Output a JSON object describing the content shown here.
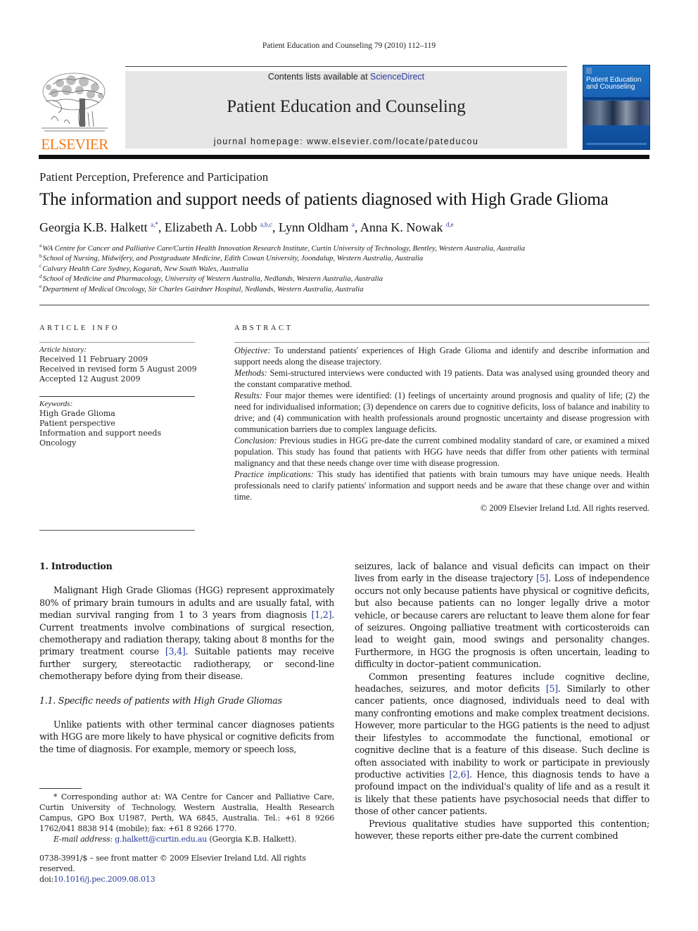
{
  "running_head": "Patient Education and Counseling 79 (2010) 112–119",
  "masthead": {
    "publisher_logo": "ELSEVIER",
    "contents_prefix": "Contents lists available at ",
    "contents_link": "ScienceDirect",
    "journal_title": "Patient Education and Counseling",
    "homepage": "journal homepage: www.elsevier.com/locate/pateducou",
    "cover_title_line1": "Patient Education",
    "cover_title_line2": "and Counseling",
    "colors": {
      "banner_bg": "#e6e6e6",
      "elsevier_orange": "#f07a1a",
      "cover_blue": "#1a62b4",
      "link_blue": "#2a3a9a"
    }
  },
  "section_label": "Patient Perception, Preference and Participation",
  "title": "The information and support needs of patients diagnosed with High Grade Glioma",
  "authors": [
    {
      "name": "Georgia K.B. Halkett",
      "sup": "a,*"
    },
    {
      "name": "Elizabeth A. Lobb",
      "sup": "a,b,c"
    },
    {
      "name": "Lynn Oldham",
      "sup": "a"
    },
    {
      "name": "Anna K. Nowak",
      "sup": "d,e"
    }
  ],
  "affiliations": [
    {
      "key": "a",
      "text": "WA Centre for Cancer and Palliative Care/Curtin Health Innovation Research Institute, Curtin University of Technology, Bentley, Western Australia, Australia"
    },
    {
      "key": "b",
      "text": "School of Nursing, Midwifery, and Postgraduate Medicine, Edith Cowan University, Joondalup, Western Australia, Australia"
    },
    {
      "key": "c",
      "text": "Calvary Health Care Sydney, Kogarah, New South Wales, Australia"
    },
    {
      "key": "d",
      "text": "School of Medicine and Pharmacology, University of Western Australia, Nedlands, Western Australia, Australia"
    },
    {
      "key": "e",
      "text": "Department of Medical Oncology, Sir Charles Gairdner Hospital, Nedlands, Western Australia, Australia"
    }
  ],
  "article_info": {
    "heading": "ARTICLE INFO",
    "history_label": "Article history:",
    "history": [
      "Received 11 February 2009",
      "Received in revised form 5 August 2009",
      "Accepted 12 August 2009"
    ],
    "keywords_label": "Keywords:",
    "keywords": [
      "High Grade Glioma",
      "Patient perspective",
      "Information and support needs",
      "Oncology"
    ]
  },
  "abstract": {
    "heading": "ABSTRACT",
    "sections": [
      {
        "label": "Objective:",
        "text": " To understand patients' experiences of High Grade Glioma and identify and describe information and support needs along the disease trajectory."
      },
      {
        "label": "Methods:",
        "text": " Semi-structured interviews were conducted with 19 patients. Data was analysed using grounded theory and the constant comparative method."
      },
      {
        "label": "Results:",
        "text": "  Four major themes were identified: (1) feelings of uncertainty around prognosis and quality of life; (2) the need for individualised information; (3) dependence on carers due to cognitive deficits, loss of balance and inability to drive; and (4) communication with health professionals around prognostic uncertainty and disease progression with communication barriers due to complex language deficits."
      },
      {
        "label": "Conclusion:",
        "text": " Previous studies in HGG pre-date the current combined modality standard of care, or examined a mixed population. This study has found that patients with HGG have needs that differ from other patients with terminal malignancy and that these needs change over time with disease progression."
      },
      {
        "label": "Practice implications:",
        "text": "  This study has identified that patients with brain tumours may have unique needs. Health professionals need to clarify patients' information and support needs and be aware that these change over and within time."
      }
    ],
    "copyright": "© 2009 Elsevier Ireland Ltd. All rights reserved."
  },
  "body": {
    "intro_heading": "1.  Introduction",
    "intro_p1": [
      {
        "t": "Malignant High Grade Gliomas (HGG) represent approximately 80% of primary brain tumours in adults and are usually fatal, with median survival ranging from 1 to 3 years from diagnosis "
      },
      {
        "ref": "[1,2]"
      },
      {
        "t": ". Current treatments involve combinations of surgical resection, chemotherapy and radiation therapy, taking about 8 months for the primary treatment course "
      },
      {
        "ref": "[3,4]"
      },
      {
        "t": ". Suitable patients may receive further surgery, stereotactic radiotherapy, or second-line chemotherapy before dying from their disease."
      }
    ],
    "subsection_heading": "1.1.  Specific needs of patients with High Grade Gliomas",
    "sub_p1": "Unlike patients with other terminal cancer diagnoses patients with HGG are more likely to have physical or cognitive deficits from the time of diagnosis. For example, memory or speech loss,",
    "right_p1": [
      {
        "t": "seizures, lack of balance and visual deficits can impact on their lives from early in the disease trajectory "
      },
      {
        "ref": "[5]"
      },
      {
        "t": ". Loss of independence occurs not only because patients have physical or cognitive deficits, but also because patients can no longer legally drive a motor vehicle, or because carers are reluctant to leave them alone for fear of seizures. Ongoing palliative treatment with corticosteroids can lead to weight gain, mood swings and personality changes. Furthermore, in HGG the prognosis is often uncertain, leading to difficulty in doctor–patient communication."
      }
    ],
    "right_p2": [
      {
        "t": "Common presenting features include cognitive decline, headaches, seizures, and motor deficits "
      },
      {
        "ref": "[5]"
      },
      {
        "t": ". Similarly to other cancer patients, once diagnosed, individuals need to deal with many confronting emotions and make complex treatment decisions. However, more particular to the HGG patients is the need to adjust their lifestyles to accommodate the functional, emotional or cognitive decline that is a feature of this disease. Such decline is often associated with inability to work or participate in previously productive activities "
      },
      {
        "ref": "[2,6]"
      },
      {
        "t": ". Hence, this diagnosis tends to have a profound impact on the individual's quality of life and as a result it is likely that these patients have psychosocial needs that differ to those of other cancer patients."
      }
    ],
    "right_p3": "Previous qualitative studies have supported this contention; however, these reports either pre-date the current combined"
  },
  "footnote": {
    "corresponding": "* Corresponding author at: WA Centre for Cancer and Palliative Care, Curtin University of Technology, Western Australia, Health Research Campus, GPO Box U1987, Perth, WA 6845, Australia. Tel.: +61 8 9266 1762/041 8838 914 (mobile); fax: +61 8 9266 1770.",
    "email_label": "E-mail address:",
    "email": "g.halkett@curtin.edu.au",
    "email_suffix": " (Georgia K.B. Halkett)."
  },
  "front_matter": {
    "issn_line": "0738-3991/$ – see front matter © 2009 Elsevier Ireland Ltd. All rights reserved.",
    "doi_prefix": "doi:",
    "doi": "10.1016/j.pec.2009.08.013"
  }
}
